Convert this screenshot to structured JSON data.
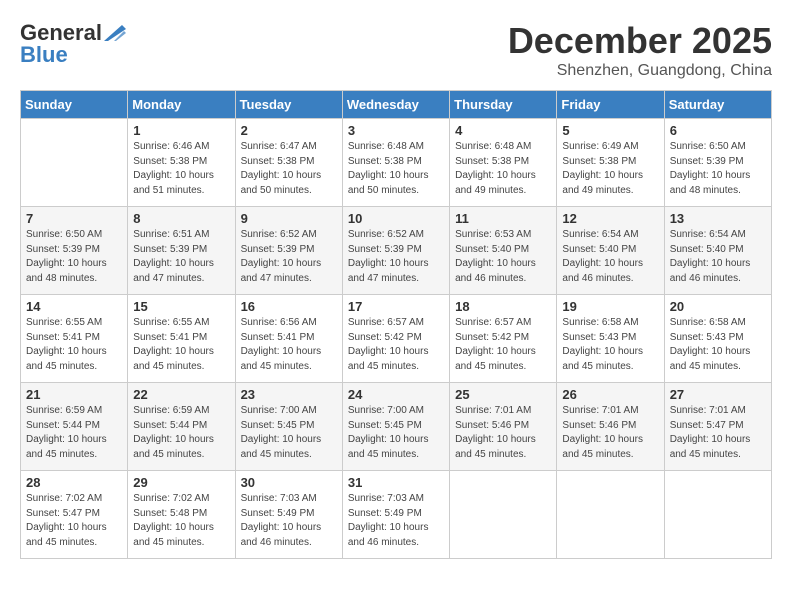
{
  "logo": {
    "line1": "General",
    "line2": "Blue"
  },
  "title": "December 2025",
  "subtitle": "Shenzhen, Guangdong, China",
  "days_of_week": [
    "Sunday",
    "Monday",
    "Tuesday",
    "Wednesday",
    "Thursday",
    "Friday",
    "Saturday"
  ],
  "weeks": [
    [
      {
        "day": "",
        "sunrise": "",
        "sunset": "",
        "daylight": ""
      },
      {
        "day": "1",
        "sunrise": "Sunrise: 6:46 AM",
        "sunset": "Sunset: 5:38 PM",
        "daylight": "Daylight: 10 hours and 51 minutes."
      },
      {
        "day": "2",
        "sunrise": "Sunrise: 6:47 AM",
        "sunset": "Sunset: 5:38 PM",
        "daylight": "Daylight: 10 hours and 50 minutes."
      },
      {
        "day": "3",
        "sunrise": "Sunrise: 6:48 AM",
        "sunset": "Sunset: 5:38 PM",
        "daylight": "Daylight: 10 hours and 50 minutes."
      },
      {
        "day": "4",
        "sunrise": "Sunrise: 6:48 AM",
        "sunset": "Sunset: 5:38 PM",
        "daylight": "Daylight: 10 hours and 49 minutes."
      },
      {
        "day": "5",
        "sunrise": "Sunrise: 6:49 AM",
        "sunset": "Sunset: 5:38 PM",
        "daylight": "Daylight: 10 hours and 49 minutes."
      },
      {
        "day": "6",
        "sunrise": "Sunrise: 6:50 AM",
        "sunset": "Sunset: 5:39 PM",
        "daylight": "Daylight: 10 hours and 48 minutes."
      }
    ],
    [
      {
        "day": "7",
        "sunrise": "Sunrise: 6:50 AM",
        "sunset": "Sunset: 5:39 PM",
        "daylight": "Daylight: 10 hours and 48 minutes."
      },
      {
        "day": "8",
        "sunrise": "Sunrise: 6:51 AM",
        "sunset": "Sunset: 5:39 PM",
        "daylight": "Daylight: 10 hours and 47 minutes."
      },
      {
        "day": "9",
        "sunrise": "Sunrise: 6:52 AM",
        "sunset": "Sunset: 5:39 PM",
        "daylight": "Daylight: 10 hours and 47 minutes."
      },
      {
        "day": "10",
        "sunrise": "Sunrise: 6:52 AM",
        "sunset": "Sunset: 5:39 PM",
        "daylight": "Daylight: 10 hours and 47 minutes."
      },
      {
        "day": "11",
        "sunrise": "Sunrise: 6:53 AM",
        "sunset": "Sunset: 5:40 PM",
        "daylight": "Daylight: 10 hours and 46 minutes."
      },
      {
        "day": "12",
        "sunrise": "Sunrise: 6:54 AM",
        "sunset": "Sunset: 5:40 PM",
        "daylight": "Daylight: 10 hours and 46 minutes."
      },
      {
        "day": "13",
        "sunrise": "Sunrise: 6:54 AM",
        "sunset": "Sunset: 5:40 PM",
        "daylight": "Daylight: 10 hours and 46 minutes."
      }
    ],
    [
      {
        "day": "14",
        "sunrise": "Sunrise: 6:55 AM",
        "sunset": "Sunset: 5:41 PM",
        "daylight": "Daylight: 10 hours and 45 minutes."
      },
      {
        "day": "15",
        "sunrise": "Sunrise: 6:55 AM",
        "sunset": "Sunset: 5:41 PM",
        "daylight": "Daylight: 10 hours and 45 minutes."
      },
      {
        "day": "16",
        "sunrise": "Sunrise: 6:56 AM",
        "sunset": "Sunset: 5:41 PM",
        "daylight": "Daylight: 10 hours and 45 minutes."
      },
      {
        "day": "17",
        "sunrise": "Sunrise: 6:57 AM",
        "sunset": "Sunset: 5:42 PM",
        "daylight": "Daylight: 10 hours and 45 minutes."
      },
      {
        "day": "18",
        "sunrise": "Sunrise: 6:57 AM",
        "sunset": "Sunset: 5:42 PM",
        "daylight": "Daylight: 10 hours and 45 minutes."
      },
      {
        "day": "19",
        "sunrise": "Sunrise: 6:58 AM",
        "sunset": "Sunset: 5:43 PM",
        "daylight": "Daylight: 10 hours and 45 minutes."
      },
      {
        "day": "20",
        "sunrise": "Sunrise: 6:58 AM",
        "sunset": "Sunset: 5:43 PM",
        "daylight": "Daylight: 10 hours and 45 minutes."
      }
    ],
    [
      {
        "day": "21",
        "sunrise": "Sunrise: 6:59 AM",
        "sunset": "Sunset: 5:44 PM",
        "daylight": "Daylight: 10 hours and 45 minutes."
      },
      {
        "day": "22",
        "sunrise": "Sunrise: 6:59 AM",
        "sunset": "Sunset: 5:44 PM",
        "daylight": "Daylight: 10 hours and 45 minutes."
      },
      {
        "day": "23",
        "sunrise": "Sunrise: 7:00 AM",
        "sunset": "Sunset: 5:45 PM",
        "daylight": "Daylight: 10 hours and 45 minutes."
      },
      {
        "day": "24",
        "sunrise": "Sunrise: 7:00 AM",
        "sunset": "Sunset: 5:45 PM",
        "daylight": "Daylight: 10 hours and 45 minutes."
      },
      {
        "day": "25",
        "sunrise": "Sunrise: 7:01 AM",
        "sunset": "Sunset: 5:46 PM",
        "daylight": "Daylight: 10 hours and 45 minutes."
      },
      {
        "day": "26",
        "sunrise": "Sunrise: 7:01 AM",
        "sunset": "Sunset: 5:46 PM",
        "daylight": "Daylight: 10 hours and 45 minutes."
      },
      {
        "day": "27",
        "sunrise": "Sunrise: 7:01 AM",
        "sunset": "Sunset: 5:47 PM",
        "daylight": "Daylight: 10 hours and 45 minutes."
      }
    ],
    [
      {
        "day": "28",
        "sunrise": "Sunrise: 7:02 AM",
        "sunset": "Sunset: 5:47 PM",
        "daylight": "Daylight: 10 hours and 45 minutes."
      },
      {
        "day": "29",
        "sunrise": "Sunrise: 7:02 AM",
        "sunset": "Sunset: 5:48 PM",
        "daylight": "Daylight: 10 hours and 45 minutes."
      },
      {
        "day": "30",
        "sunrise": "Sunrise: 7:03 AM",
        "sunset": "Sunset: 5:49 PM",
        "daylight": "Daylight: 10 hours and 46 minutes."
      },
      {
        "day": "31",
        "sunrise": "Sunrise: 7:03 AM",
        "sunset": "Sunset: 5:49 PM",
        "daylight": "Daylight: 10 hours and 46 minutes."
      },
      {
        "day": "",
        "sunrise": "",
        "sunset": "",
        "daylight": ""
      },
      {
        "day": "",
        "sunrise": "",
        "sunset": "",
        "daylight": ""
      },
      {
        "day": "",
        "sunrise": "",
        "sunset": "",
        "daylight": ""
      }
    ]
  ]
}
